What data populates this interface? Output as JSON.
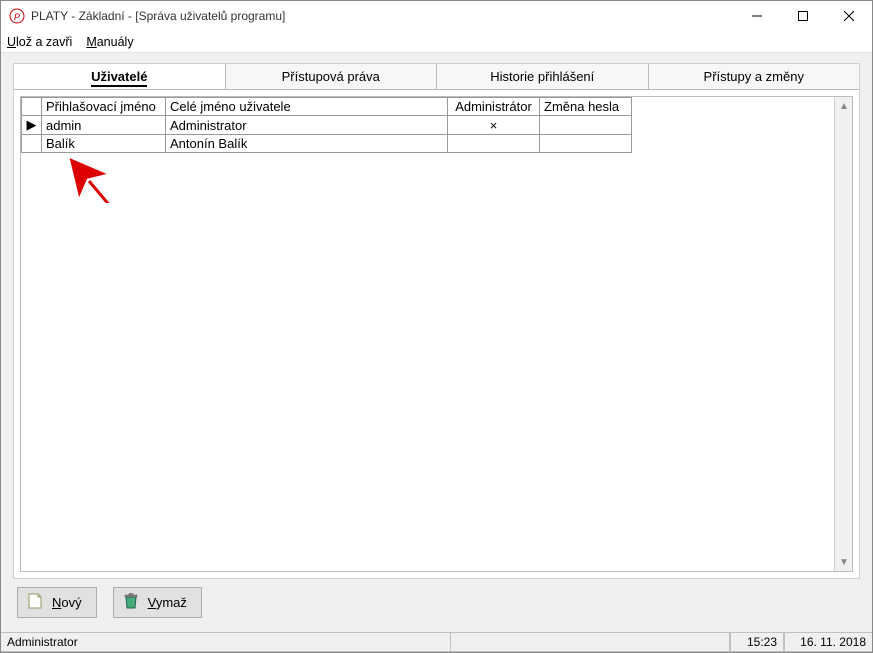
{
  "window": {
    "title": "PLATY  - Základní - [Správa uživatelů programu]"
  },
  "menu": {
    "save_close": "Ulož a zavři",
    "manuals": "Manuály"
  },
  "tabs": {
    "users": "Uživatelé",
    "rights": "Přístupová práva",
    "history": "Historie přihlášení",
    "access_changes": "Přístupy a změny"
  },
  "grid": {
    "headers": {
      "login": "Přihlašovací jméno",
      "fullname": "Celé jméno uživatele",
      "admin": "Administrátor",
      "pwdchange": "Změna hesla"
    },
    "rows": [
      {
        "selected": true,
        "login": "admin",
        "fullname": "Administrator",
        "admin": "×",
        "pwdchange": ""
      },
      {
        "selected": false,
        "login": "Balík",
        "fullname": "Antonín Balík",
        "admin": "",
        "pwdchange": ""
      }
    ]
  },
  "buttons": {
    "new": "Nový",
    "delete": "Vymaž"
  },
  "status": {
    "user": "Administrator",
    "time": "15:23",
    "date": "16. 11. 2018"
  }
}
